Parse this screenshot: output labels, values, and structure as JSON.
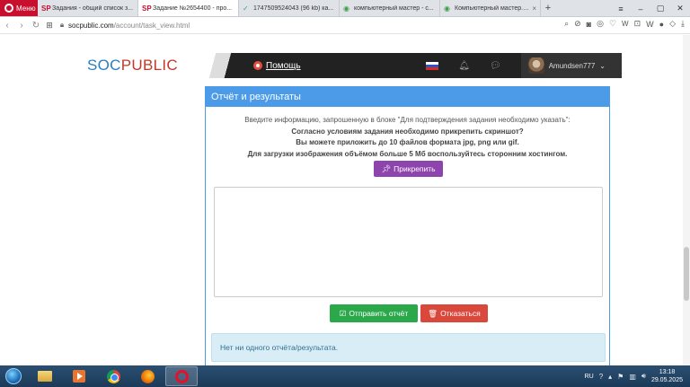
{
  "browser": {
    "menu_label": "Меню",
    "tabs": [
      {
        "favicon": "SP",
        "title": "Задания - общий список з...",
        "active": false
      },
      {
        "favicon": "SP",
        "title": "Задание №2654400 - про...",
        "active": true
      },
      {
        "favicon": "✓",
        "title": "1747509524043 (96 kb) ка...",
        "active": false
      },
      {
        "favicon": "◉",
        "title": "компьютерный мастер - с...",
        "active": false
      },
      {
        "favicon": "◉",
        "title": "Компьютерный мастер. С...",
        "active": false
      }
    ],
    "url_domain": "socpublic.com",
    "url_path": "/account/task_view.html"
  },
  "site": {
    "logo_part1": "SOC",
    "logo_part2": "PUBLIC",
    "help_label": "Помощь",
    "username": "Amundsen777"
  },
  "panel": {
    "title": "Отчёт и результаты",
    "info_line1": "Введите информацию, запрошенную в блоке \"Для подтверждения задания необходимо указать\":",
    "info_line2": "Согласно условиям задания необходимо прикрепить скриншот?",
    "info_line3": "Вы можете приложить до 10 файлов формата jpg, png или gif.",
    "info_line4": "Для загрузки изображения объёмом больше 5 Мб воспользуйтесь сторонним хостингом.",
    "attach_label": "Прикрепить",
    "report_value": "",
    "send_label": "Отправить отчёт",
    "decline_label": "Отказаться",
    "alert_text": "Нет ни одного отчёта/результата."
  },
  "taskbar": {
    "lang": "RU",
    "time": "13:18",
    "date": "29.05.2025"
  },
  "colors": {
    "panel_blue": "#4c9be8",
    "attach_purple": "#8e44ad",
    "send_green": "#2aa84a",
    "decline_red": "#d9483b",
    "opera_red": "#c8102e"
  }
}
